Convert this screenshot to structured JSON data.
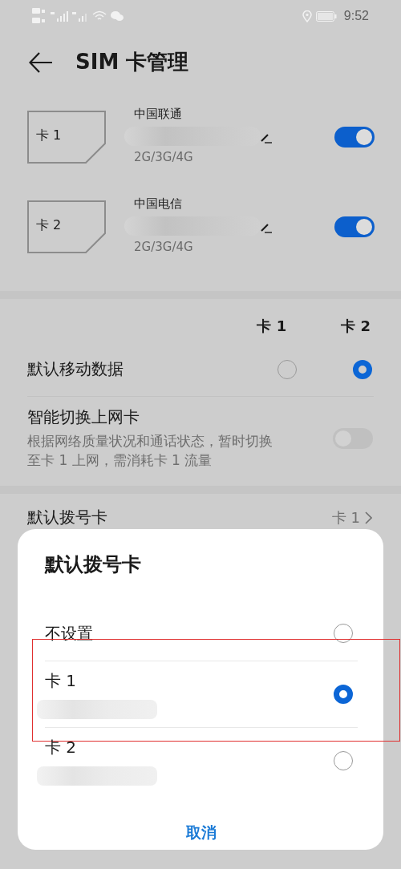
{
  "status_bar": {
    "time": "9:52"
  },
  "header": {
    "title": "SIM 卡管理"
  },
  "sim_cards": [
    {
      "label": "卡 1",
      "carrier": "中国联通",
      "network": "2G/3G/4G",
      "on": true,
      "redacted": true
    },
    {
      "label": "卡 2",
      "carrier": "中国电信",
      "network": "2G/3G/4G",
      "on": true,
      "redacted": true
    }
  ],
  "columns": [
    "卡 1",
    "卡 2"
  ],
  "mobile_data": {
    "label": "默认移动数据",
    "options": [
      {
        "selected": false
      },
      {
        "selected": true
      }
    ]
  },
  "smart_switch": {
    "title": "智能切换上网卡",
    "description": "根据网络质量状况和通话状态，暂时切换至卡 1 上网，需消耗卡 1 流量",
    "on": false
  },
  "default_dial": {
    "label": "默认拨号卡",
    "value": "卡 1"
  },
  "dialog": {
    "title": "默认拨号卡",
    "options": [
      {
        "label": "不设置",
        "selected": false,
        "redacted": false,
        "highlighted": false
      },
      {
        "label": "卡 1",
        "selected": true,
        "redacted": true,
        "highlighted": true
      },
      {
        "label": "卡 2",
        "selected": false,
        "redacted": true,
        "highlighted": false
      }
    ],
    "cancel": "取消"
  }
}
